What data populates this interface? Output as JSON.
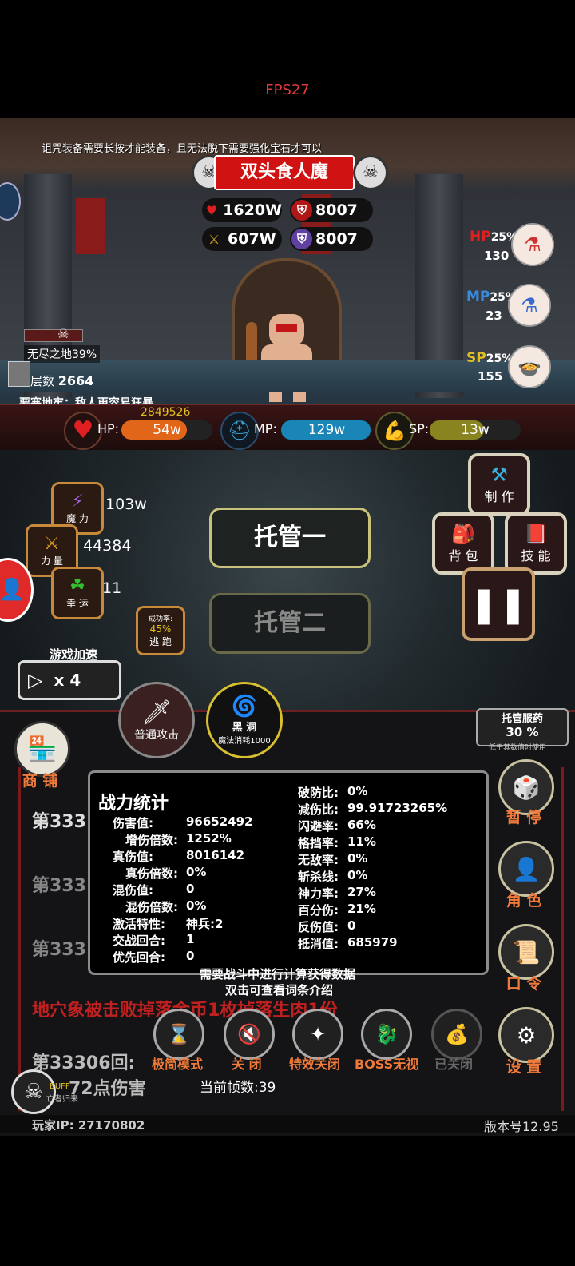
{
  "fps": "FPS27",
  "hint": "诅咒装备需要长按才能装备，且无法脱下需要强化宝石才可以",
  "boss": {
    "name": "双头食人魔",
    "hp": "1620W",
    "atk": "607W",
    "def": "8007",
    "mdef": "8007"
  },
  "potions": {
    "hp": {
      "label": "HP",
      "pct": "25%",
      "value": "130"
    },
    "mp": {
      "label": "MP",
      "pct": "25%",
      "value": "23"
    },
    "sp": {
      "label": "SP",
      "pct": "25%",
      "value": "155"
    }
  },
  "map": {
    "zone": "无尽之地39%",
    "floor_label": "层数",
    "floor": "2664",
    "effect": "要塞地牢：敌人更容易狂暴"
  },
  "player": {
    "hp_max": "2849526",
    "hp_label": "HP:",
    "hp": "54w",
    "mp_label": "MP:",
    "mp": "129w",
    "sp_label": "SP:",
    "sp": "13w",
    "hp_fill": 0.72,
    "mp_fill": 0.98,
    "sp_fill": 0.6
  },
  "stats": {
    "magic_label": "魔 力",
    "magic": "103w",
    "power_label": "力 量",
    "power": "44384",
    "luck_label": "幸 运",
    "luck": "11",
    "escape_rate_label": "成功率:",
    "escape_rate": "45%",
    "escape_label": "逃 跑"
  },
  "auto": {
    "btn1": "托管一",
    "btn2": "托管二"
  },
  "speed": {
    "label": "游戏加速",
    "value": "x 4"
  },
  "menu": {
    "craft": "制 作",
    "bag": "背 包",
    "skill": "技 能"
  },
  "attacks": {
    "normal": "普通攻击",
    "blackhole": "黑 洞",
    "blackhole_cost": "魔法消耗1000"
  },
  "auto_potion": {
    "label": "托管服药",
    "pct": "30 %",
    "sub": "低于其数值时使用"
  },
  "shop": "商 铺",
  "right_buttons": {
    "pause": "暂 停",
    "role": "角 色",
    "code": "口 令",
    "settings": "设 置"
  },
  "log": [
    "第333",
    "第333",
    "第333",
    "地穴象被击败掉落金币1枚掉落生肉1份",
    "第33306回:",
    "72点伤害"
  ],
  "panel": {
    "title": "战力统计",
    "left": [
      {
        "k": "伤害值:",
        "v": "96652492"
      },
      {
        "k": "增伤倍数:",
        "v": "1252%"
      },
      {
        "k": "真伤值:",
        "v": "8016142"
      },
      {
        "k": "真伤倍数:",
        "v": "0%"
      },
      {
        "k": "混伤值:",
        "v": "0"
      },
      {
        "k": "混伤倍数:",
        "v": "0%"
      },
      {
        "k": "激活特性:",
        "v": "神兵:2"
      },
      {
        "k": "交战回合:",
        "v": "1"
      },
      {
        "k": "优先回合:",
        "v": "0"
      }
    ],
    "right": [
      {
        "k": "破防比:",
        "v": "0%"
      },
      {
        "k": "减伤比:",
        "v": "99.91723265%"
      },
      {
        "k": "闪避率:",
        "v": "66%"
      },
      {
        "k": "格挡率:",
        "v": "11%"
      },
      {
        "k": "无敌率:",
        "v": "0%"
      },
      {
        "k": "斩杀线:",
        "v": "0%"
      },
      {
        "k": "神力率:",
        "v": "27%"
      },
      {
        "k": "百分伤:",
        "v": "21%"
      },
      {
        "k": "反伤值:",
        "v": "0"
      },
      {
        "k": "抵消值:",
        "v": "685979"
      }
    ],
    "note1": "需要战斗中进行计算获得数据",
    "note2": "双击可查看词条介绍"
  },
  "toolbar": {
    "simple": "极简模式",
    "mute": "关 闭",
    "fx": "特效关闭",
    "boss": "BOSS无视",
    "closed": "已关闭"
  },
  "buff": {
    "label": "BUFF",
    "sub": "亡者归来"
  },
  "frames": {
    "label": "当前帧数:",
    "value": "39"
  },
  "footer": {
    "ip_label": "玩家IP:",
    "ip": "27170802",
    "version": "版本号12.95"
  }
}
